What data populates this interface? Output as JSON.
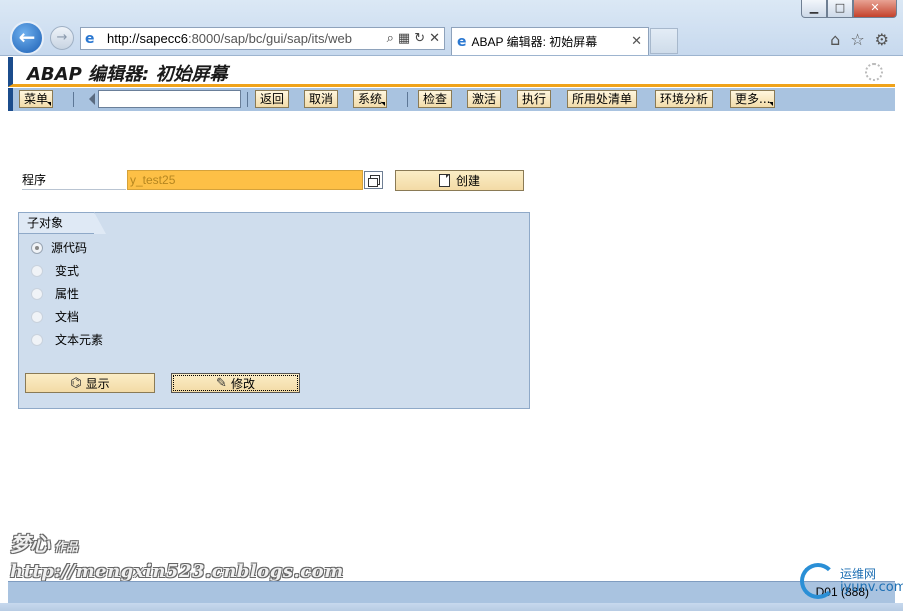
{
  "browser": {
    "url_host": "http://sapecc6",
    "url_rest": ":8000/sap/bc/gui/sap/its/web",
    "tab_title": "ABAP 编辑器: 初始屏幕",
    "win_min": "▁",
    "win_max": "□",
    "win_close": "✕"
  },
  "sap": {
    "title": "ABAP 编辑器: 初始屏幕",
    "toolbar": {
      "menu": "菜单",
      "back": "返回",
      "cancel": "取消",
      "system": "系统",
      "check": "检查",
      "activate": "激活",
      "execute": "执行",
      "where_used": "所用处清单",
      "env_analysis": "环境分析",
      "more": "更多..."
    },
    "program": {
      "label": "程序",
      "value": "y_test25",
      "create_label": "创建"
    },
    "subobjects": {
      "title": "子对象",
      "options": [
        "源代码",
        "变式",
        "属性",
        "文档",
        "文本元素"
      ],
      "selected": 0
    },
    "actions": {
      "display": "显示",
      "change": "修改"
    },
    "status": {
      "system": "D01 (888)"
    }
  },
  "watermark": {
    "name": "梦心",
    "sub": "作品",
    "url": "http://mengxin523.cnblogs.com"
  },
  "logo": {
    "line1": "运维网",
    "line2": "iyunv.com"
  }
}
